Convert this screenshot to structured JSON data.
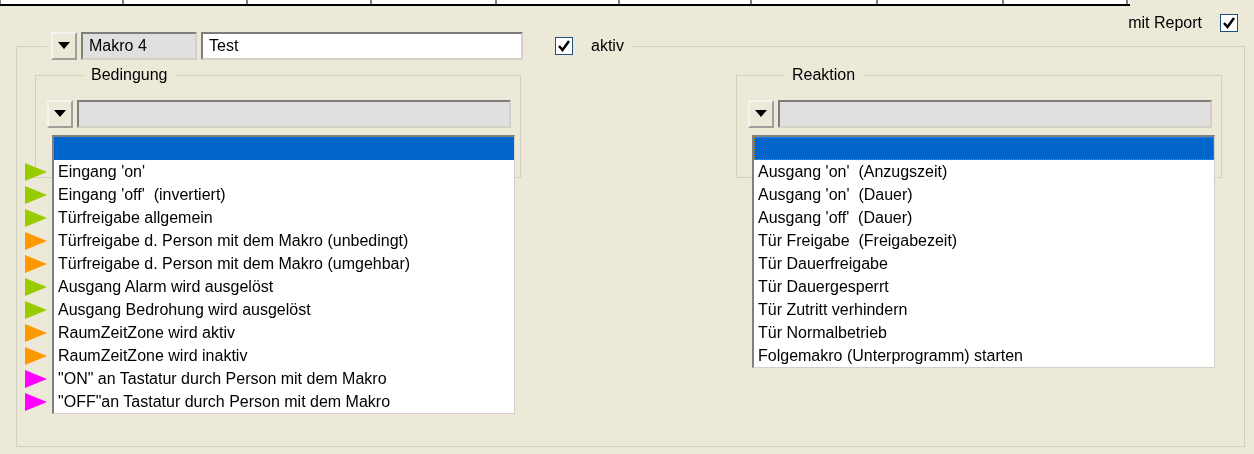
{
  "report": {
    "label": "mit Report",
    "checked": true
  },
  "macro": {
    "number": "Makro 4",
    "name": "Test",
    "active": {
      "label": "aktiv",
      "checked": true
    }
  },
  "condition": {
    "title": "Bedingung",
    "items": [
      {
        "selected": true
      },
      {
        "label": "Eingang 'on'",
        "selected": false,
        "color": "#99cc00"
      },
      {
        "label": "Eingang 'off'  (invertiert)",
        "selected": false,
        "color": "#99cc00"
      },
      {
        "label": "Türfreigabe allgemein",
        "selected": false,
        "color": "#99cc00"
      },
      {
        "label": "Türfreigabe d. Person mit dem Makro (unbedingt)",
        "selected": false,
        "color": "#ff9900"
      },
      {
        "label": "Türfreigabe d. Person mit dem Makro (umgehbar)",
        "selected": false,
        "color": "#ff9900"
      },
      {
        "label": "Ausgang Alarm wird ausgelöst",
        "selected": false,
        "color": "#99cc00"
      },
      {
        "label": "Ausgang Bedrohung wird ausgelöst",
        "selected": false,
        "color": "#99cc00"
      },
      {
        "label": "RaumZeitZone wird aktiv",
        "selected": false,
        "color": "#ff9900"
      },
      {
        "label": "RaumZeitZone wird inaktiv",
        "selected": false,
        "color": "#ff9900"
      },
      {
        "label": "\"ON\" an Tastatur durch Person mit dem Makro",
        "selected": false,
        "color": "#ff00ff"
      },
      {
        "label": "\"OFF\"an Tastatur durch Person mit dem Makro",
        "selected": false,
        "color": "#ff00ff"
      }
    ]
  },
  "reaction": {
    "title": "Reaktion",
    "items": [
      {
        "selected": true
      },
      {
        "label": "Ausgang 'on'  (Anzugszeit)",
        "selected": false
      },
      {
        "label": "Ausgang 'on'  (Dauer)",
        "selected": false
      },
      {
        "label": "Ausgang 'off'  (Dauer)",
        "selected": false
      },
      {
        "label": "Tür Freigabe  (Freigabezeit)",
        "selected": false
      },
      {
        "label": "Tür Dauerfreigabe",
        "selected": false
      },
      {
        "label": "Tür Dauergesperrt",
        "selected": false
      },
      {
        "label": "Tür Zutritt verhindern",
        "selected": false
      },
      {
        "label": "Tür Normalbetrieb",
        "selected": false
      },
      {
        "label": "Folgemakro (Unterprogramm) starten",
        "selected": false
      }
    ]
  }
}
